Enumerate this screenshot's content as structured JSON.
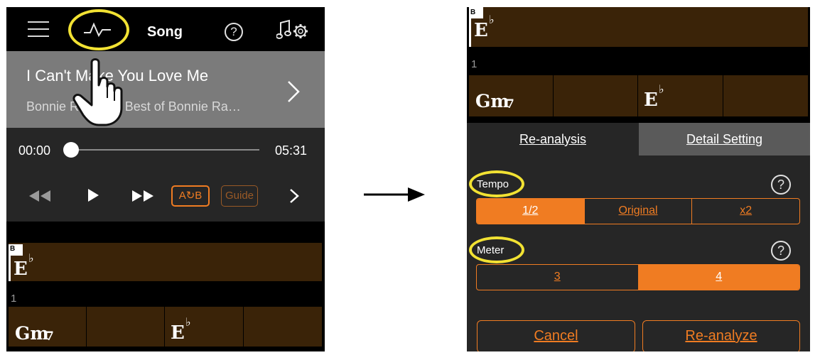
{
  "left_screen": {
    "header": {
      "title": "Song",
      "help_symbol": "?"
    },
    "song": {
      "title": "I Can't Make You Love Me",
      "artist": "Bonnie Raitt  The Best of Bonnie Ra…"
    },
    "player": {
      "current_time": "00:00",
      "total_time": "05:31",
      "progress": 0
    },
    "transport": {
      "ab_label": "A↻B",
      "guide_label": "Guide"
    },
    "chords": {
      "section": "B",
      "row1": "E",
      "row1_accidental": "♭",
      "measure": "1",
      "row2_first": "Gm",
      "row2_first_suffix": "7",
      "row2_second": "E",
      "row2_second_accidental": "♭"
    }
  },
  "right_screen": {
    "chords": {
      "section": "B",
      "row1": "E",
      "row1_accidental": "♭",
      "measure": "1",
      "row2_first": "Gm",
      "row2_first_suffix": "7",
      "row2_second": "E",
      "row2_second_accidental": "♭"
    },
    "tabs": [
      {
        "label": "Re-analysis",
        "active": true
      },
      {
        "label": "Detail Setting",
        "active": false
      }
    ],
    "tempo": {
      "label": "Tempo",
      "options": [
        "1/2",
        "Original",
        "x2"
      ],
      "selected": "1/2"
    },
    "meter": {
      "label": "Meter",
      "options": [
        "3",
        "4"
      ],
      "selected": "4"
    },
    "help_symbol": "?",
    "buttons": {
      "cancel": "Cancel",
      "reanalyze": "Re-analyze"
    }
  },
  "colors": {
    "accent": "#f07c22",
    "highlight": "#f2e233",
    "chord_bar": "#3a2308",
    "panel": "#262626"
  },
  "icons": [
    "hamburger-icon",
    "pulse-icon",
    "help-icon",
    "music-settings-icon",
    "chevron-right-icon",
    "rewind-icon",
    "play-icon",
    "fast-forward-icon",
    "pointing-hand-icon",
    "arrow-right-icon"
  ]
}
